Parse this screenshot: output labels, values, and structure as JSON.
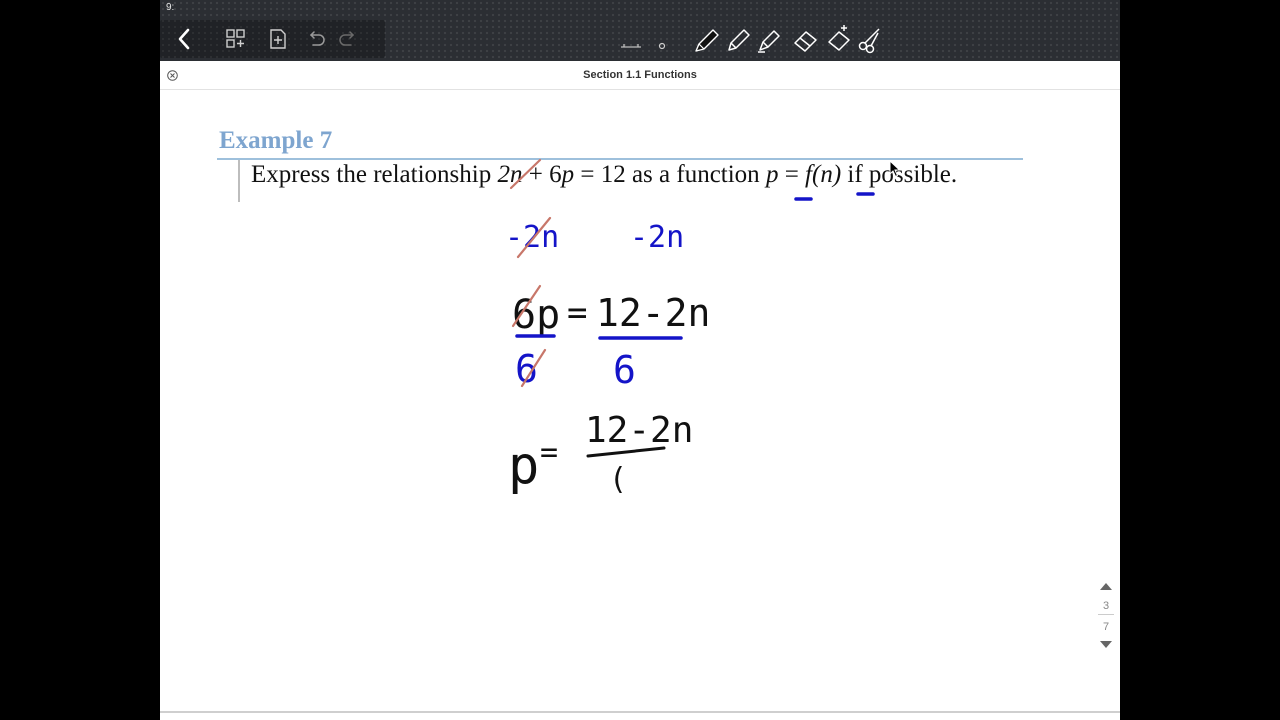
{
  "status_bar": {
    "time": "9:"
  },
  "toolbar": {
    "left_buttons": [
      "back-icon",
      "thumbnails-icon",
      "add-page-icon",
      "undo-icon",
      "redo-icon"
    ],
    "tools": [
      "lasso-icon",
      "shape-icon",
      "pen-icon",
      "pencil-icon",
      "highlighter-icon",
      "eraser-icon",
      "smart-eraser-icon",
      "scissors-icon"
    ]
  },
  "document": {
    "title": "Section 1.1 Functions"
  },
  "content": {
    "example_heading": "Example 7",
    "problem": {
      "part1": "Express the relationship ",
      "var_n1": "2n",
      "part2": " + 6",
      "var_p1": "p",
      "part3": " = 12 as a function ",
      "var_p2": "p",
      "part4": " = ",
      "func": "f(n)",
      "part5": " if possible."
    },
    "handwriting": {
      "line1_left": "-2n",
      "line1_right": "-2n",
      "line2_left": "6p",
      "line2_eq": "=",
      "line2_right": "12-2n",
      "line2_den_left": "6",
      "line2_den_right": "6",
      "line3_left": "p",
      "line3_eq": "=",
      "line3_num": "12-2n",
      "line3_den": "("
    },
    "colors": {
      "heading": "#7ea5cf",
      "blue_ink": "#1414c8",
      "black_ink": "#111111",
      "red_ink": "#c8776a"
    }
  },
  "pager": {
    "current": "3",
    "total": "7"
  }
}
